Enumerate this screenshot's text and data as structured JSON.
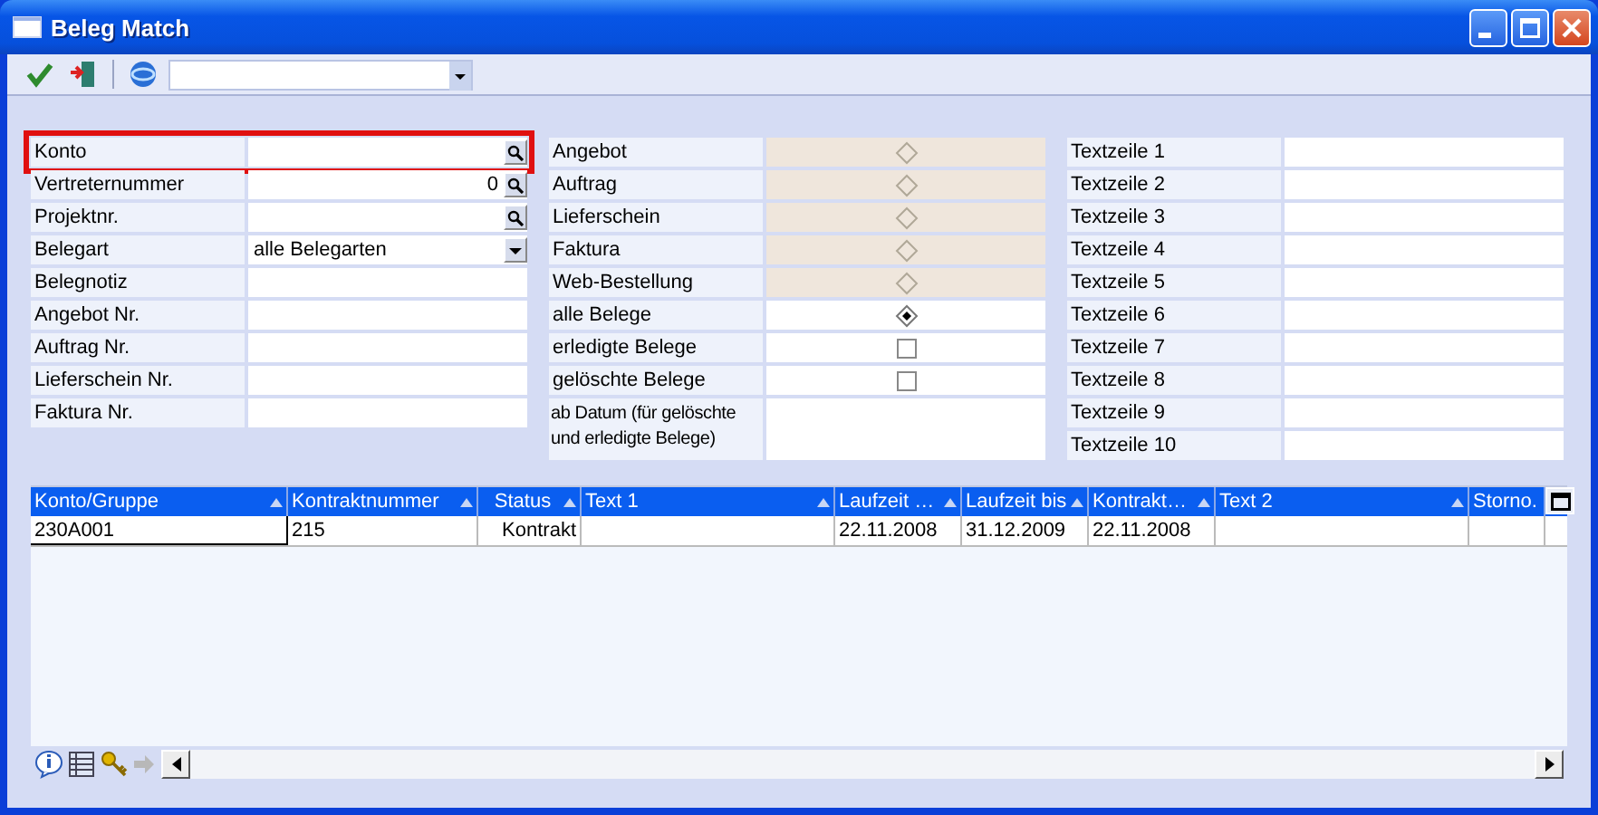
{
  "window": {
    "title": "Beleg Match"
  },
  "filters": [
    {
      "label": "Konto",
      "kind": "search",
      "focused": true
    },
    {
      "label": "Vertreternummer",
      "value": "0",
      "kind": "search",
      "focused": false
    },
    {
      "label": "Projektnr.",
      "kind": "search",
      "focused": false
    },
    {
      "label": "Belegart",
      "value": "alle Belegarten",
      "kind": "dropdown",
      "focused": false
    },
    {
      "label": "Belegnotiz",
      "kind": "plain",
      "focused": false
    },
    {
      "label": "Angebot Nr.",
      "kind": "plain",
      "focused": false
    },
    {
      "label": "Auftrag Nr.",
      "kind": "plain",
      "focused": false
    },
    {
      "label": "Lieferschein Nr.",
      "kind": "plain",
      "focused": false
    },
    {
      "label": "Faktura Nr.",
      "kind": "plain",
      "focused": false
    }
  ],
  "options": [
    {
      "label": "Angebot",
      "kind": "radio",
      "checked": false,
      "disabled": true
    },
    {
      "label": "Auftrag",
      "kind": "radio",
      "checked": false,
      "disabled": true
    },
    {
      "label": "Lieferschein",
      "kind": "radio",
      "checked": false,
      "disabled": true
    },
    {
      "label": "Faktura",
      "kind": "radio",
      "checked": false,
      "disabled": true
    },
    {
      "label": "Web-Bestellung",
      "kind": "radio",
      "checked": false,
      "disabled": true
    },
    {
      "label": "alle Belege",
      "kind": "radio",
      "checked": true,
      "disabled": false
    },
    {
      "label": "erledigte Belege",
      "kind": "checkbox",
      "checked": false,
      "disabled": false
    },
    {
      "label": "gelöschte Belege",
      "kind": "checkbox",
      "checked": false,
      "disabled": false
    },
    {
      "label": "ab Datum (für gelöschte und erledigte Belege)",
      "kind": "field"
    }
  ],
  "text_lines": [
    {
      "label": "Textzeile 1"
    },
    {
      "label": "Textzeile 2"
    },
    {
      "label": "Textzeile 3"
    },
    {
      "label": "Textzeile 4"
    },
    {
      "label": "Textzeile 5"
    },
    {
      "label": "Textzeile 6"
    },
    {
      "label": "Textzeile 7"
    },
    {
      "label": "Textzeile 8"
    },
    {
      "label": "Textzeile 9"
    },
    {
      "label": "Textzeile 10"
    }
  ],
  "table": {
    "columns": [
      {
        "label": "Konto/Gruppe",
        "sort_arrow": true
      },
      {
        "label": "Kontraktnummer",
        "sort_arrow": true
      },
      {
        "label": "Status",
        "sort_arrow": true
      },
      {
        "label": "Text 1",
        "sort_arrow": true
      },
      {
        "label": "Laufzeit …",
        "sort_arrow": true
      },
      {
        "label": "Laufzeit bis",
        "sort_arrow": true
      },
      {
        "label": "Kontrakt…",
        "sort_arrow": true
      },
      {
        "label": "Text 2",
        "sort_arrow": true
      },
      {
        "label": "Storno.",
        "sort_arrow": false
      }
    ],
    "rows": [
      {
        "cells": [
          "230A001",
          "215",
          "Kontrakt",
          null,
          "22.11.2008",
          "31.12.2009",
          "22.11.2008",
          null,
          null
        ]
      }
    ]
  }
}
